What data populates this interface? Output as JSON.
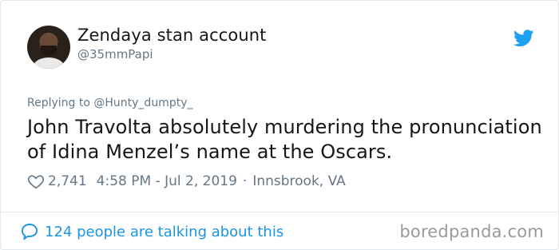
{
  "user": {
    "display_name": "Zendaya stan account",
    "handle": "@35mmPapi"
  },
  "tweet": {
    "replying_to": "Replying to @Hunty_dumpty_",
    "text": "John Travolta absolutely murdering the pronunciation of Idina Menzel’s name at the Oscars.",
    "likes": "2,741",
    "timestamp": "4:58 PM - Jul 2, 2019",
    "separator": "·",
    "location": "Innsbrook, VA"
  },
  "footer": {
    "talking": "124 people are talking about this",
    "watermark": "boredpanda.com"
  },
  "icons": {
    "brand": "twitter-bird-icon",
    "like": "heart-icon",
    "reply": "speech-bubble-icon"
  },
  "colors": {
    "twitter_blue": "#1da1f2",
    "link_blue": "#1b95e0",
    "secondary_text": "#657786",
    "primary_text": "#14171a"
  }
}
